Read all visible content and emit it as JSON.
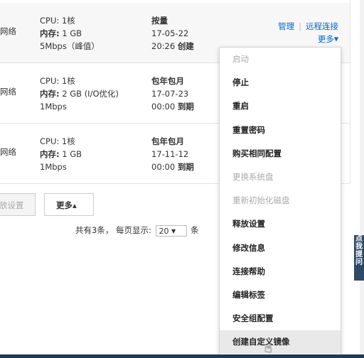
{
  "rows": [
    {
      "network": "网络",
      "cpu_label": "CPU:",
      "cpu_value": "1核",
      "mem_label": "内存:",
      "mem_value": "1 GB",
      "bandwidth": "5Mbps（峰值）",
      "billing_type": "按量",
      "date": "17-05-22",
      "time": "20:26",
      "time_suffix": "创建",
      "manage": "管理",
      "remote": "远程连接",
      "more": "更多"
    },
    {
      "network": "网络",
      "cpu_label": "CPU:",
      "cpu_value": "1核",
      "mem_label": "内存:",
      "mem_value": "2 GB (I/O优化)",
      "bandwidth": "1Mbps",
      "billing_type": "包年包月",
      "date": "17-07-23",
      "time": "00:00",
      "time_suffix": "到期"
    },
    {
      "network": "网络",
      "cpu_label": "CPU:",
      "cpu_value": "1核",
      "mem_label": "内存:",
      "mem_value": "1 GB",
      "bandwidth": "1Mbps",
      "billing_type": "包年包月",
      "date": "17-11-12",
      "time": "00:00",
      "time_suffix": "到期"
    }
  ],
  "bottom": {
    "release_label": "放设置",
    "more_label": "更多▴"
  },
  "pager": {
    "total": "共有3条，",
    "per_page": "每页显示:",
    "size": "20",
    "unit": "条"
  },
  "menu": [
    {
      "label": "启动",
      "disabled": true
    },
    {
      "label": "停止",
      "disabled": false
    },
    {
      "label": "重启",
      "disabled": false
    },
    {
      "label": "重置密码",
      "disabled": false
    },
    {
      "label": "购买相同配置",
      "disabled": false
    },
    {
      "label": "更换系统盘",
      "disabled": true
    },
    {
      "label": "重新初始化磁盘",
      "disabled": true
    },
    {
      "label": "释放设置",
      "disabled": false
    },
    {
      "label": "修改信息",
      "disabled": false
    },
    {
      "label": "连接帮助",
      "disabled": false
    },
    {
      "label": "编辑标签",
      "disabled": false
    },
    {
      "label": "安全组配置",
      "disabled": false
    },
    {
      "label": "创建自定义镜像",
      "disabled": false
    }
  ],
  "side_tab": "点我提问",
  "colors": {
    "link": "#0066cc",
    "sidebar": "#2f4a66"
  }
}
